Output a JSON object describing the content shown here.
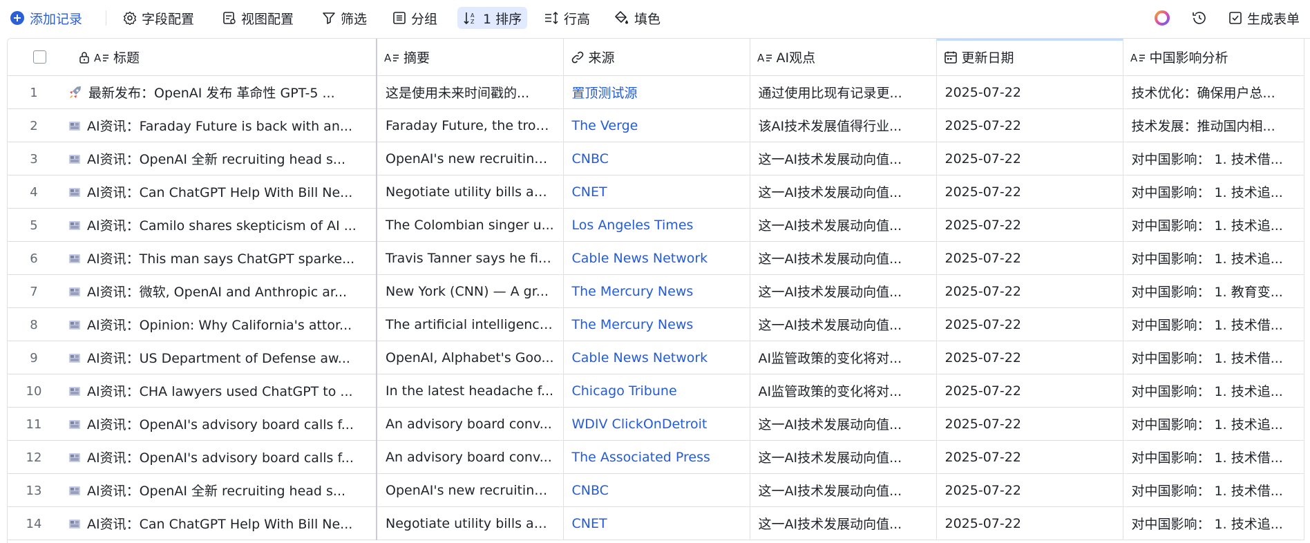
{
  "toolbar": {
    "add_record": "添加记录",
    "field_config": "字段配置",
    "view_config": "视图配置",
    "filter": "筛选",
    "group": "分组",
    "sort": "1 排序",
    "row_height": "行高",
    "fill_color": "填色",
    "generate_form": "生成表单"
  },
  "columns": {
    "title": "标题",
    "summary": "摘要",
    "source": "来源",
    "ai_view": "AI观点",
    "update_date": "更新日期",
    "china_impact": "中国影响分析"
  },
  "rows": [
    {
      "num": "1",
      "icon": "rocket-icon",
      "title": "最新发布：OpenAI 发布 革命性 GPT-5 ...",
      "summary": "这是使用未来时间戳的...",
      "source": "置顶测试源",
      "ai_view": "通过使用比现有记录更...",
      "date": "2025-07-22",
      "impact": "技术优化：确保用户总..."
    },
    {
      "num": "2",
      "icon": "newspaper-icon",
      "title": "AI资讯：Faraday Future is back with an...",
      "summary": "Faraday Future, the trou...",
      "source": "The Verge",
      "ai_view": "该AI技术发展值得行业...",
      "date": "2025-07-22",
      "impact": "技术发展：推动国内相..."
    },
    {
      "num": "3",
      "icon": "newspaper-icon",
      "title": "AI资讯：OpenAI 全新 recruiting head s...",
      "summary": "OpenAI's new recruiting...",
      "source": "CNBC",
      "ai_view": "这一AI技术发展动向值...",
      "date": "2025-07-22",
      "impact": "对中国影响： 1. 技术借..."
    },
    {
      "num": "4",
      "icon": "newspaper-icon",
      "title": "AI资讯：Can ChatGPT Help With Bill Ne...",
      "summary": "Negotiate utility bills an...",
      "source": "CNET",
      "ai_view": "这一AI技术发展动向值...",
      "date": "2025-07-22",
      "impact": "对中国影响： 1. 技术追..."
    },
    {
      "num": "5",
      "icon": "newspaper-icon",
      "title": "AI资讯：Camilo shares skepticism of AI ...",
      "summary": "The Colombian singer u...",
      "source": "Los Angeles Times",
      "ai_view": "这一AI技术发展动向值...",
      "date": "2025-07-22",
      "impact": "对中国影响： 1. 技术追..."
    },
    {
      "num": "6",
      "icon": "newspaper-icon",
      "title": "AI资讯：This man says ChatGPT sparke...",
      "summary": "Travis Tanner says he fir...",
      "source": "Cable News Network",
      "ai_view": "这一AI技术发展动向值...",
      "date": "2025-07-22",
      "impact": "对中国影响： 1. 技术追..."
    },
    {
      "num": "7",
      "icon": "newspaper-icon",
      "title": "AI资讯：微软, OpenAI and Anthropic ar...",
      "summary": "New York (CNN) — A gr...",
      "source": "The Mercury News",
      "ai_view": "这一AI技术发展动向值...",
      "date": "2025-07-22",
      "impact": "对中国影响： 1. 教育变..."
    },
    {
      "num": "8",
      "icon": "newspaper-icon",
      "title": "AI资讯：Opinion: Why California's attor...",
      "summary": "The artificial intelligence...",
      "source": "The Mercury News",
      "ai_view": "这一AI技术发展动向值...",
      "date": "2025-07-22",
      "impact": "对中国影响： 1. 技术借..."
    },
    {
      "num": "9",
      "icon": "newspaper-icon",
      "title": "AI资讯：US Department of Defense aw...",
      "summary": "OpenAI, Alphabet's Goo...",
      "source": "Cable News Network",
      "ai_view": "AI监管政策的变化将对...",
      "date": "2025-07-22",
      "impact": "对中国影响： 1. 技术借..."
    },
    {
      "num": "10",
      "icon": "newspaper-icon",
      "title": "AI资讯：CHA lawyers used ChatGPT to ...",
      "summary": "In the latest headache f...",
      "source": "Chicago Tribune",
      "ai_view": "AI监管政策的变化将对...",
      "date": "2025-07-22",
      "impact": "对中国影响： 1. 技术追..."
    },
    {
      "num": "11",
      "icon": "newspaper-icon",
      "title": "AI资讯：OpenAI's advisory board calls f...",
      "summary": "An advisory board conv...",
      "source": "WDIV ClickOnDetroit",
      "ai_view": "这一AI技术发展动向值...",
      "date": "2025-07-22",
      "impact": "对中国影响： 1. 技术追..."
    },
    {
      "num": "12",
      "icon": "newspaper-icon",
      "title": "AI资讯：OpenAI's advisory board calls f...",
      "summary": "An advisory board conv...",
      "source": "The Associated Press",
      "ai_view": "这一AI技术发展动向值...",
      "date": "2025-07-22",
      "impact": "对中国影响： 1. 技术借..."
    },
    {
      "num": "13",
      "icon": "newspaper-icon",
      "title": "AI资讯：OpenAI 全新 recruiting head s...",
      "summary": "OpenAI's new recruiting...",
      "source": "CNBC",
      "ai_view": "这一AI技术发展动向值...",
      "date": "2025-07-22",
      "impact": "对中国影响： 1. 技术借..."
    },
    {
      "num": "14",
      "icon": "newspaper-icon",
      "title": "AI资讯：Can ChatGPT Help With Bill Ne...",
      "summary": "Negotiate utility bills an...",
      "source": "CNET",
      "ai_view": "这一AI技术发展动向值...",
      "date": "2025-07-22",
      "impact": "对中国影响： 1. 技术追..."
    }
  ],
  "colors": {
    "accent": "#2b5fd9",
    "link": "#245bdb",
    "border": "#dee0e3",
    "sort_bg": "#e1eaff"
  }
}
